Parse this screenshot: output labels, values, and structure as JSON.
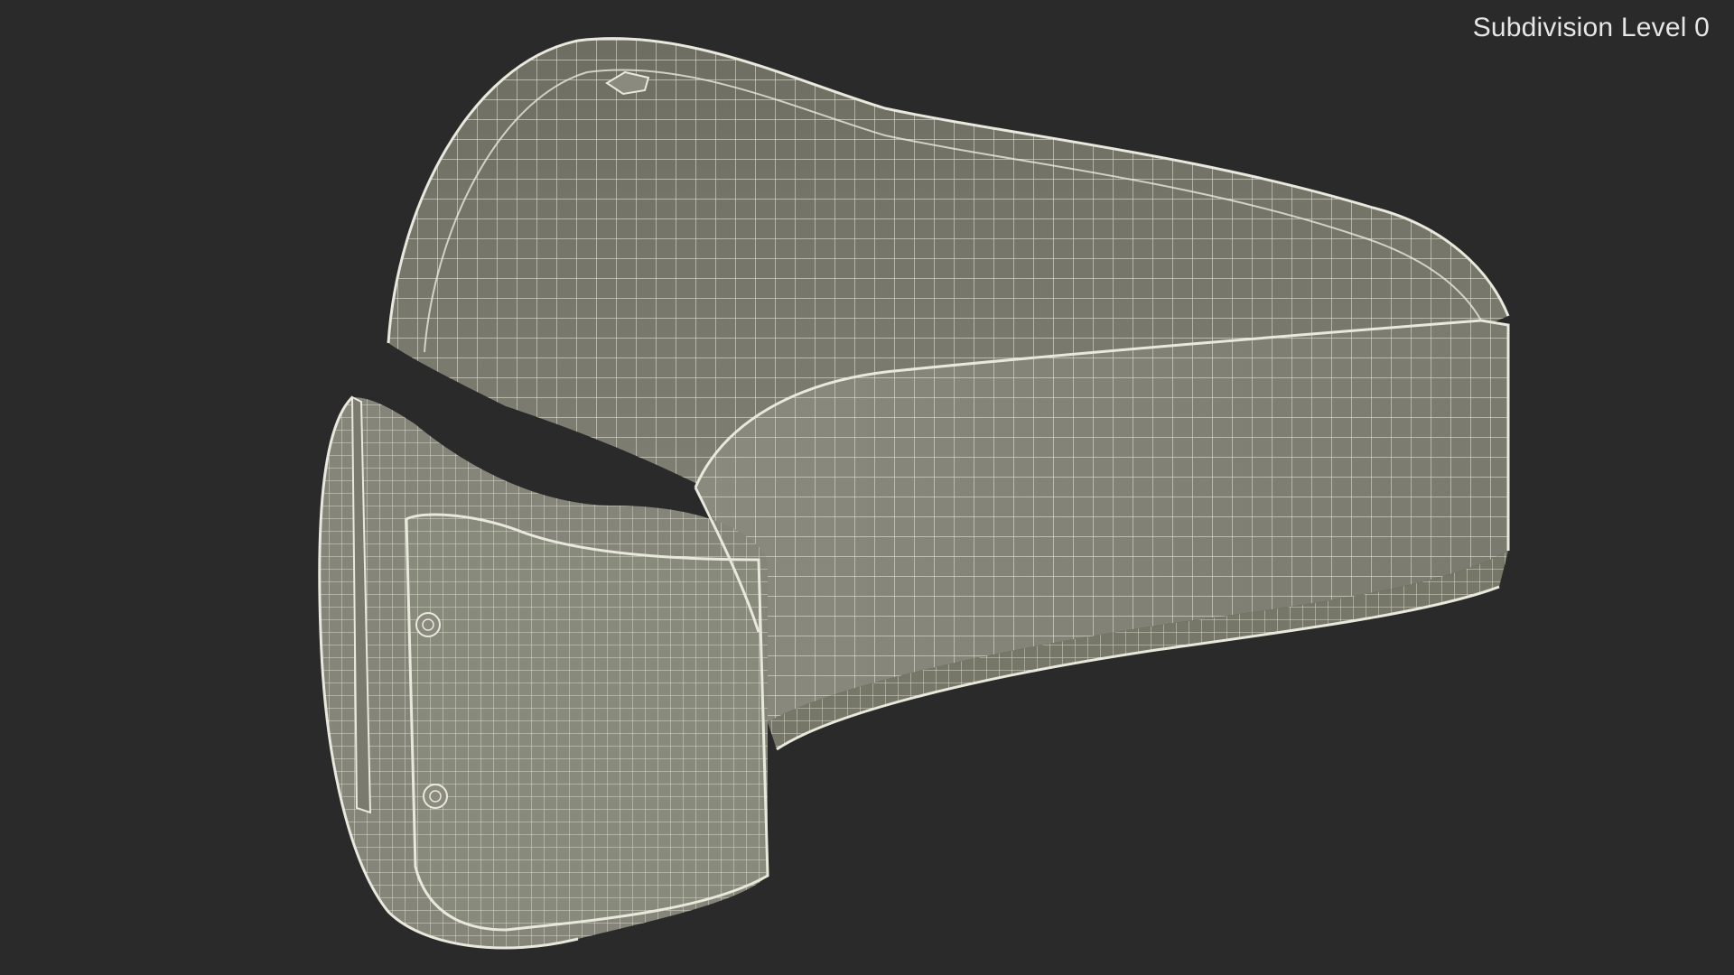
{
  "viewport": {
    "subdivision_label": "Subdivision Level 0",
    "background_color": "#2a2a2a",
    "mesh_fill_color": "#7a7a6e",
    "wire_color": "#e8e8dc"
  },
  "model": {
    "object": "belt-wireframe-model"
  }
}
